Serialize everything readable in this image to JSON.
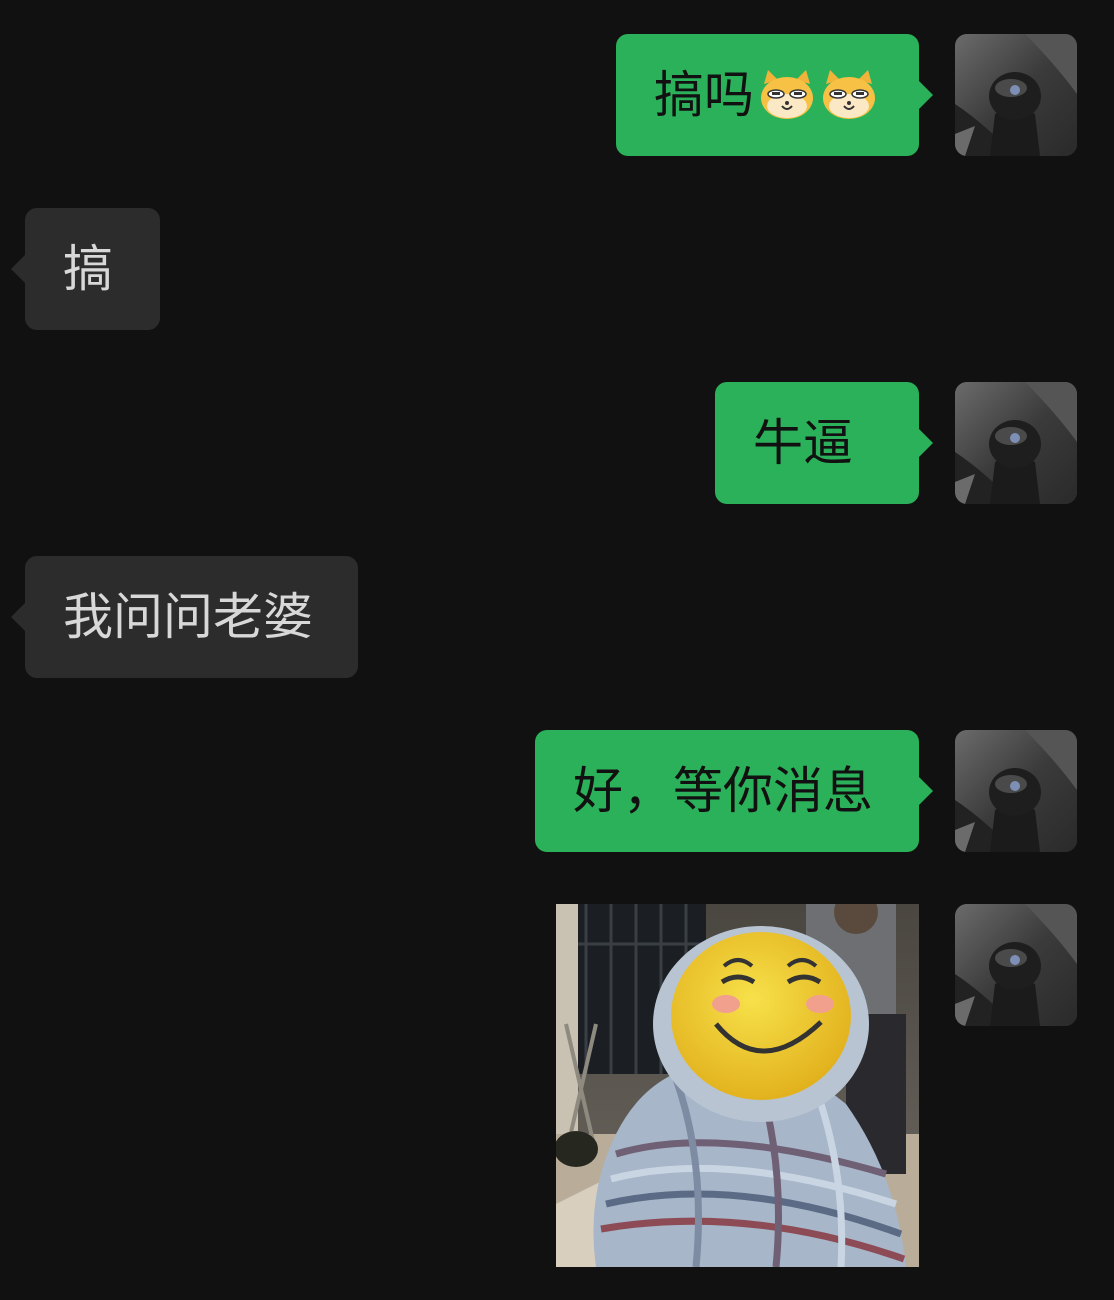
{
  "messages": [
    {
      "side": "out",
      "text": "搞吗",
      "emoji_icons": [
        "doge-cat-emoji",
        "doge-cat-emoji"
      ]
    },
    {
      "side": "in",
      "text": "搞"
    },
    {
      "side": "out",
      "text": "牛逼"
    },
    {
      "side": "in",
      "text": "我问问老婆"
    },
    {
      "side": "out",
      "text": "好，等你消息"
    },
    {
      "side": "out",
      "type": "image",
      "icon": "smiley-face-mask-photo"
    }
  ],
  "avatar": {
    "icon": "gear-shift-knob-avatar"
  },
  "colors": {
    "background": "#111111",
    "outgoing_bubble": "#2bb15a",
    "incoming_bubble": "#2c2c2c",
    "incoming_text": "#d8d8d8",
    "outgoing_text": "#111111"
  }
}
